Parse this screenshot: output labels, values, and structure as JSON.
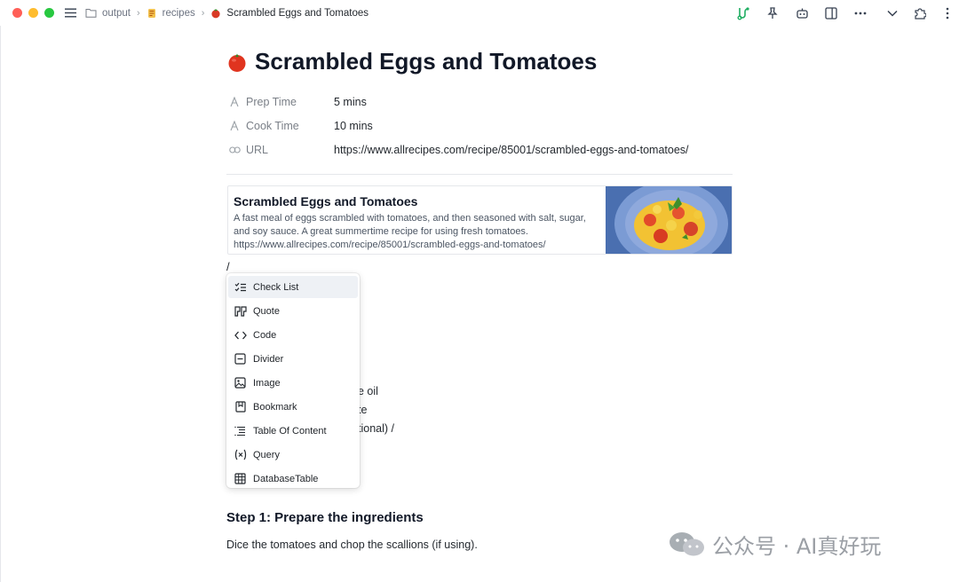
{
  "breadcrumb": {
    "items": [
      {
        "label": "output",
        "icon": "folder-icon"
      },
      {
        "label": "recipes",
        "icon": "recipes-emoji-icon"
      },
      {
        "label": "Scrambled Eggs and Tomatoes",
        "icon": "tomato-icon"
      }
    ]
  },
  "toolbar": {
    "icons": [
      "graph-view-icon",
      "pin-icon",
      "ai-robot-icon",
      "split-panel-icon",
      "more-icon",
      "chevron-down-icon",
      "extensions-icon",
      "vertical-more-icon"
    ],
    "accent": "#1fae62"
  },
  "page": {
    "title": "Scrambled Eggs and Tomatoes",
    "title_emoji": "tomato-icon"
  },
  "properties": [
    {
      "name": "Prep Time",
      "value": "5 mins",
      "icon": "text-property-icon"
    },
    {
      "name": "Cook Time",
      "value": "10 mins",
      "icon": "text-property-icon"
    },
    {
      "name": "URL",
      "value": "https://www.allrecipes.com/recipe/85001/scrambled-eggs-and-tomatoes/",
      "icon": "link-icon"
    }
  ],
  "bookmark": {
    "title": "Scrambled Eggs and Tomatoes",
    "description": "A fast meal of eggs scrambled with tomatoes, and then seasoned with salt, sugar, and soy sauce. A great summertime recipe for using fresh tomatoes.",
    "url": "https://www.allrecipes.com/recipe/85001/scrambled-eggs-and-tomatoes/",
    "image": "scrambled-eggs-photo"
  },
  "editor": {
    "slash_text": "/",
    "fragments": [
      "e oil",
      "te",
      "tional) /"
    ]
  },
  "slash_menu": {
    "items": [
      {
        "label": "Check List",
        "icon": "checklist-icon",
        "active": true
      },
      {
        "label": "Quote",
        "icon": "quote-icon"
      },
      {
        "label": "Code",
        "icon": "code-icon"
      },
      {
        "label": "Divider",
        "icon": "divider-icon"
      },
      {
        "label": "Image",
        "icon": "image-icon"
      },
      {
        "label": "Bookmark",
        "icon": "bookmark-icon"
      },
      {
        "label": "Table Of Content",
        "icon": "toc-icon"
      },
      {
        "label": "Query",
        "icon": "query-icon"
      },
      {
        "label": "DatabaseTable",
        "icon": "table-icon"
      }
    ]
  },
  "content": {
    "step1_heading": "Step 1: Prepare the ingredients",
    "step1_text": "Dice the tomatoes and chop the scallions (if using)."
  },
  "watermark": {
    "text": "公众号 · AI真好玩"
  }
}
